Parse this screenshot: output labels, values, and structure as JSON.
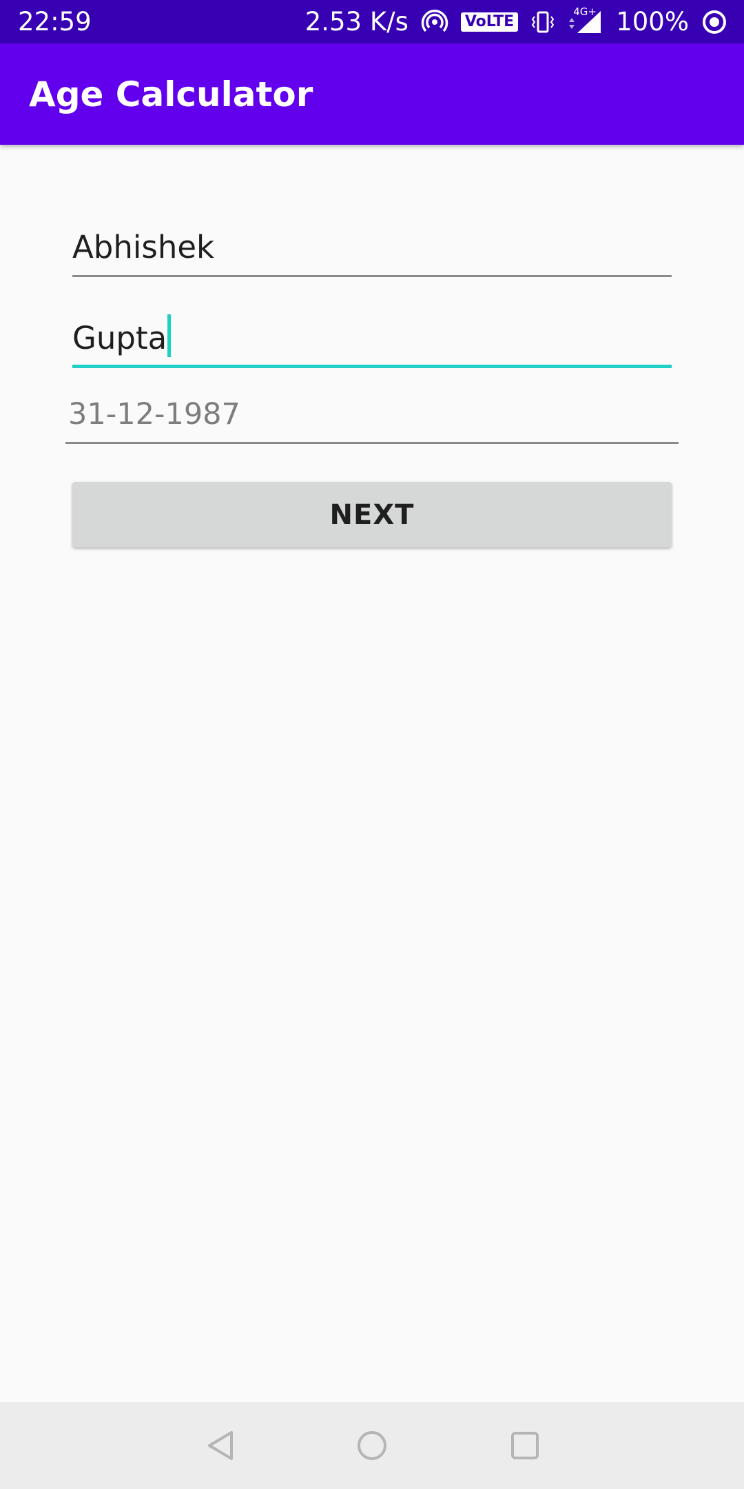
{
  "status_bar": {
    "time": "22:59",
    "network_speed": "2.53 K/s",
    "volte_label": "VoLTE",
    "network_type": "4G+",
    "battery": "100%",
    "icons": [
      "hotspot-icon",
      "volte-icon",
      "vibrate-icon",
      "signal-icon",
      "battery-icon"
    ]
  },
  "app_bar": {
    "title": "Age Calculator",
    "color": "#6200ee",
    "status_color": "#3700b3"
  },
  "form": {
    "first_name": {
      "value": "Abhishek"
    },
    "last_name": {
      "value": "Gupta",
      "focused": true,
      "accent_color": "#1fd0c6"
    },
    "date_of_birth": {
      "placeholder": "31-12-1987"
    },
    "next_button": {
      "label": "NEXT"
    }
  },
  "nav_bar": {
    "icons": [
      "back-icon",
      "home-icon",
      "recents-icon"
    ]
  }
}
